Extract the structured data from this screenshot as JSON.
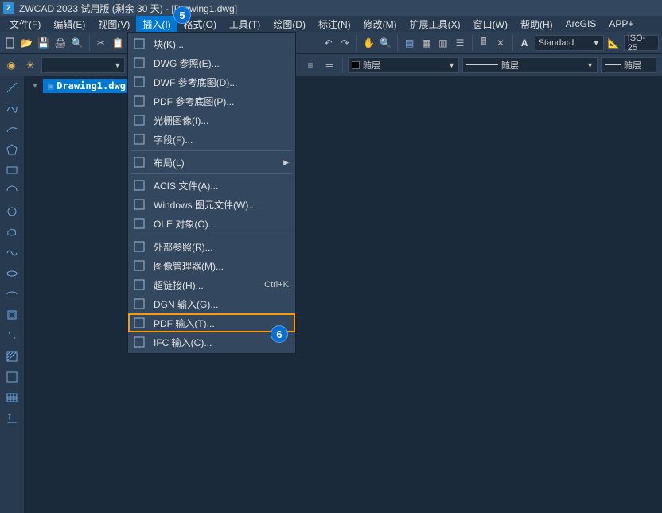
{
  "title": "ZWCAD 2023 试用版 (剩余 30 天) - [Drawing1.dwg]",
  "menubar": [
    "文件(F)",
    "编辑(E)",
    "视图(V)",
    "插入(I)",
    "格式(O)",
    "工具(T)",
    "绘图(D)",
    "标注(N)",
    "修改(M)",
    "扩展工具(X)",
    "窗口(W)",
    "帮助(H)",
    "ArcGIS",
    "APP+"
  ],
  "menubar_active_index": 3,
  "callouts": {
    "c5": "5",
    "c6": "6"
  },
  "toolbar2": {
    "style_label": "Standard",
    "dim_label": "ISO-25"
  },
  "layer_row": {
    "combo1": "随层",
    "combo2": "随层",
    "combo3": "随层"
  },
  "tab": {
    "current": "Drawing1.dwg"
  },
  "dropdown": {
    "items": [
      {
        "label": "块(K)..."
      },
      {
        "label": "DWG 参照(E)..."
      },
      {
        "label": "DWF 参考底图(D)..."
      },
      {
        "label": "PDF 参考底图(P)..."
      },
      {
        "label": "光栅图像(I)..."
      },
      {
        "label": "字段(F)..."
      },
      {
        "sep": true
      },
      {
        "label": "布局(L)",
        "submenu": true
      },
      {
        "sep": true
      },
      {
        "label": "ACIS 文件(A)..."
      },
      {
        "label": "Windows 图元文件(W)..."
      },
      {
        "label": "OLE 对象(O)..."
      },
      {
        "sep": true
      },
      {
        "label": "外部参照(R)..."
      },
      {
        "label": "图像管理器(M)..."
      },
      {
        "label": "超链接(H)...",
        "shortcut": "Ctrl+K"
      },
      {
        "label": "DGN 输入(G)..."
      },
      {
        "label": "PDF 输入(T)...",
        "highlighted": true
      },
      {
        "label": "IFC 输入(C)..."
      }
    ]
  }
}
